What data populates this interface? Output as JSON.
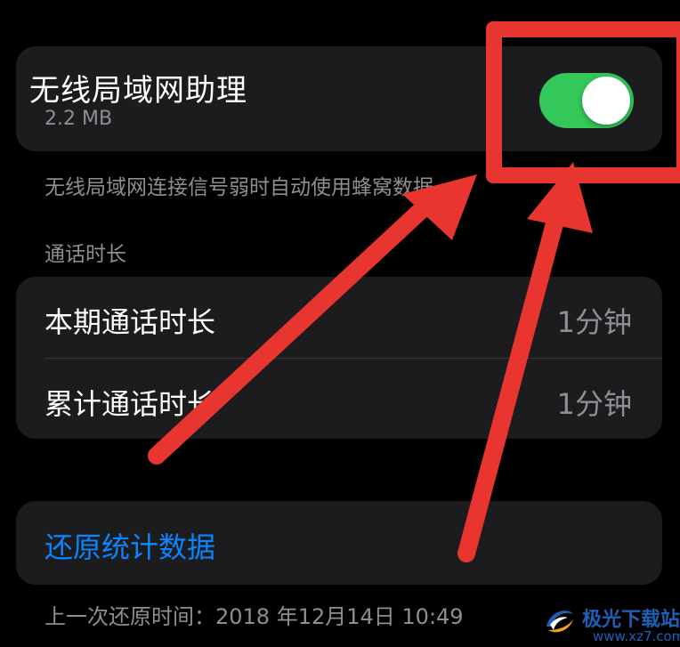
{
  "wifi_assist": {
    "title": "无线局域网助理",
    "size": "2.2 MB",
    "enabled": true,
    "description": "无线局域网连接信号弱时自动使用蜂窝数据。"
  },
  "call_duration": {
    "section_header": "通话时长",
    "rows": [
      {
        "label": "本期通话时长",
        "value": "1分钟"
      },
      {
        "label": "累计通话时长",
        "value": "1分钟"
      }
    ]
  },
  "reset": {
    "link_label": "还原统计数据",
    "last_reset": "上一次还原时间：2018 年12月14日 10:49"
  },
  "annotation": {
    "color": "#e8352f"
  },
  "watermark": {
    "name": "极光下载站",
    "url": "www.xz7.com"
  },
  "colors": {
    "toggle_on": "#34c759",
    "link": "#0a84ff",
    "secondary_text": "#8e8e93"
  }
}
